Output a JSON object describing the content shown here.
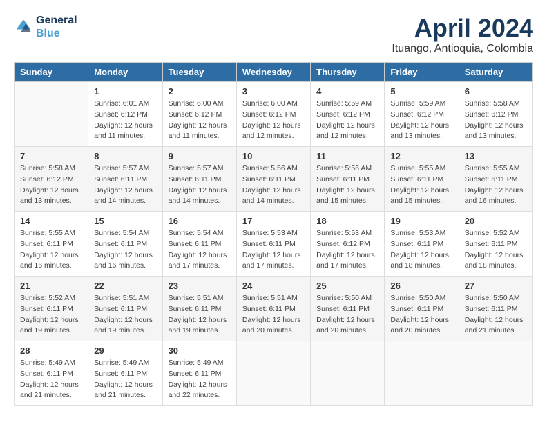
{
  "header": {
    "logo_line1": "General",
    "logo_line2": "Blue",
    "title": "April 2024",
    "subtitle": "Ituango, Antioquia, Colombia"
  },
  "calendar": {
    "headers": [
      "Sunday",
      "Monday",
      "Tuesday",
      "Wednesday",
      "Thursday",
      "Friday",
      "Saturday"
    ],
    "weeks": [
      [
        {
          "day": "",
          "info": ""
        },
        {
          "day": "1",
          "info": "Sunrise: 6:01 AM\nSunset: 6:12 PM\nDaylight: 12 hours\nand 11 minutes."
        },
        {
          "day": "2",
          "info": "Sunrise: 6:00 AM\nSunset: 6:12 PM\nDaylight: 12 hours\nand 11 minutes."
        },
        {
          "day": "3",
          "info": "Sunrise: 6:00 AM\nSunset: 6:12 PM\nDaylight: 12 hours\nand 12 minutes."
        },
        {
          "day": "4",
          "info": "Sunrise: 5:59 AM\nSunset: 6:12 PM\nDaylight: 12 hours\nand 12 minutes."
        },
        {
          "day": "5",
          "info": "Sunrise: 5:59 AM\nSunset: 6:12 PM\nDaylight: 12 hours\nand 13 minutes."
        },
        {
          "day": "6",
          "info": "Sunrise: 5:58 AM\nSunset: 6:12 PM\nDaylight: 12 hours\nand 13 minutes."
        }
      ],
      [
        {
          "day": "7",
          "info": "Sunrise: 5:58 AM\nSunset: 6:12 PM\nDaylight: 12 hours\nand 13 minutes."
        },
        {
          "day": "8",
          "info": "Sunrise: 5:57 AM\nSunset: 6:11 PM\nDaylight: 12 hours\nand 14 minutes."
        },
        {
          "day": "9",
          "info": "Sunrise: 5:57 AM\nSunset: 6:11 PM\nDaylight: 12 hours\nand 14 minutes."
        },
        {
          "day": "10",
          "info": "Sunrise: 5:56 AM\nSunset: 6:11 PM\nDaylight: 12 hours\nand 14 minutes."
        },
        {
          "day": "11",
          "info": "Sunrise: 5:56 AM\nSunset: 6:11 PM\nDaylight: 12 hours\nand 15 minutes."
        },
        {
          "day": "12",
          "info": "Sunrise: 5:55 AM\nSunset: 6:11 PM\nDaylight: 12 hours\nand 15 minutes."
        },
        {
          "day": "13",
          "info": "Sunrise: 5:55 AM\nSunset: 6:11 PM\nDaylight: 12 hours\nand 16 minutes."
        }
      ],
      [
        {
          "day": "14",
          "info": "Sunrise: 5:55 AM\nSunset: 6:11 PM\nDaylight: 12 hours\nand 16 minutes."
        },
        {
          "day": "15",
          "info": "Sunrise: 5:54 AM\nSunset: 6:11 PM\nDaylight: 12 hours\nand 16 minutes."
        },
        {
          "day": "16",
          "info": "Sunrise: 5:54 AM\nSunset: 6:11 PM\nDaylight: 12 hours\nand 17 minutes."
        },
        {
          "day": "17",
          "info": "Sunrise: 5:53 AM\nSunset: 6:11 PM\nDaylight: 12 hours\nand 17 minutes."
        },
        {
          "day": "18",
          "info": "Sunrise: 5:53 AM\nSunset: 6:12 PM\nDaylight: 12 hours\nand 17 minutes."
        },
        {
          "day": "19",
          "info": "Sunrise: 5:53 AM\nSunset: 6:11 PM\nDaylight: 12 hours\nand 18 minutes."
        },
        {
          "day": "20",
          "info": "Sunrise: 5:52 AM\nSunset: 6:11 PM\nDaylight: 12 hours\nand 18 minutes."
        }
      ],
      [
        {
          "day": "21",
          "info": "Sunrise: 5:52 AM\nSunset: 6:11 PM\nDaylight: 12 hours\nand 19 minutes."
        },
        {
          "day": "22",
          "info": "Sunrise: 5:51 AM\nSunset: 6:11 PM\nDaylight: 12 hours\nand 19 minutes."
        },
        {
          "day": "23",
          "info": "Sunrise: 5:51 AM\nSunset: 6:11 PM\nDaylight: 12 hours\nand 19 minutes."
        },
        {
          "day": "24",
          "info": "Sunrise: 5:51 AM\nSunset: 6:11 PM\nDaylight: 12 hours\nand 20 minutes."
        },
        {
          "day": "25",
          "info": "Sunrise: 5:50 AM\nSunset: 6:11 PM\nDaylight: 12 hours\nand 20 minutes."
        },
        {
          "day": "26",
          "info": "Sunrise: 5:50 AM\nSunset: 6:11 PM\nDaylight: 12 hours\nand 20 minutes."
        },
        {
          "day": "27",
          "info": "Sunrise: 5:50 AM\nSunset: 6:11 PM\nDaylight: 12 hours\nand 21 minutes."
        }
      ],
      [
        {
          "day": "28",
          "info": "Sunrise: 5:49 AM\nSunset: 6:11 PM\nDaylight: 12 hours\nand 21 minutes."
        },
        {
          "day": "29",
          "info": "Sunrise: 5:49 AM\nSunset: 6:11 PM\nDaylight: 12 hours\nand 21 minutes."
        },
        {
          "day": "30",
          "info": "Sunrise: 5:49 AM\nSunset: 6:11 PM\nDaylight: 12 hours\nand 22 minutes."
        },
        {
          "day": "",
          "info": ""
        },
        {
          "day": "",
          "info": ""
        },
        {
          "day": "",
          "info": ""
        },
        {
          "day": "",
          "info": ""
        }
      ]
    ]
  }
}
